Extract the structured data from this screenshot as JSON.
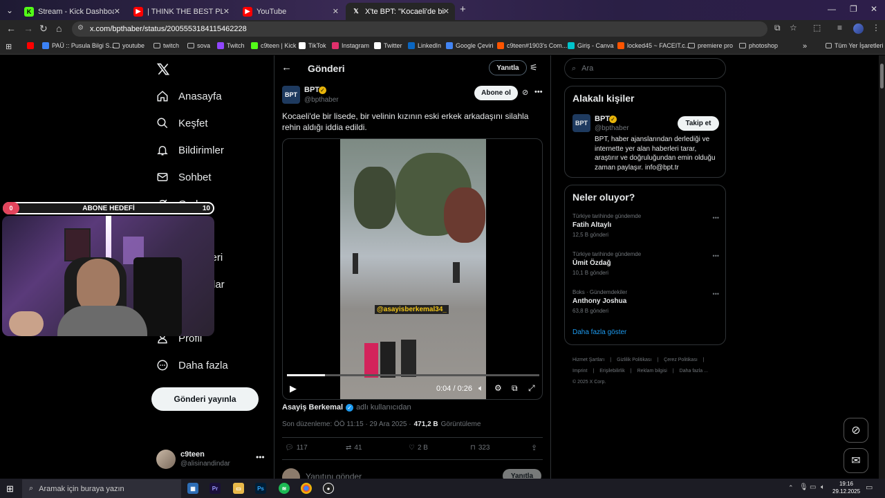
{
  "browser": {
    "tabs": [
      {
        "title": "Stream - Kick Dashboard -",
        "icon": "kick-icon",
        "color": "#53fc18"
      },
      {
        "title": "| THINK THE BEST PLAYER IS 👑",
        "icon": "youtube-icon",
        "color": "#ff0000"
      },
      {
        "title": "YouTube",
        "icon": "youtube-icon",
        "color": "#ff0000"
      },
      {
        "title": "X'te BPT: \"Kocaeli'de bir lisede",
        "icon": "x-icon",
        "color": "#ffffff"
      }
    ],
    "url": "x.com/bpthaber/status/2005553184115462228",
    "bookmarks": [
      {
        "label": "",
        "icon": "youtube-icon",
        "color": "#ff0000"
      },
      {
        "label": "PAÜ :: Pusula Bilgi S...",
        "icon": "globe-icon",
        "color": "#3b82f6"
      },
      {
        "label": "youtube",
        "icon": "folder-icon",
        "color": "#bbbbbb"
      },
      {
        "label": "twitch",
        "icon": "folder-icon",
        "color": "#bbbbbb"
      },
      {
        "label": "sova",
        "icon": "folder-icon",
        "color": "#bbbbbb"
      },
      {
        "label": "Twitch",
        "icon": "twitch-icon",
        "color": "#9146ff"
      },
      {
        "label": "c9teen | Kick",
        "icon": "kick-icon",
        "color": "#53fc18"
      },
      {
        "label": "TikTok",
        "icon": "tiktok-icon",
        "color": "#ffffff"
      },
      {
        "label": "Instagram",
        "icon": "instagram-icon",
        "color": "#e1306c"
      },
      {
        "label": "Twitter",
        "icon": "x-icon",
        "color": "#ffffff"
      },
      {
        "label": "LinkedIn",
        "icon": "linkedin-icon",
        "color": "#0a66c2"
      },
      {
        "label": "Google Çeviri",
        "icon": "translate-icon",
        "color": "#4285f4"
      },
      {
        "label": "c9teen#1903's Com...",
        "icon": "faceit-icon",
        "color": "#ff5500"
      },
      {
        "label": "Giriş - Canva",
        "icon": "canva-icon",
        "color": "#00c4cc"
      },
      {
        "label": "locked45 ~ FACEIT.c...",
        "icon": "faceit-icon",
        "color": "#ff5500"
      },
      {
        "label": "premiere pro",
        "icon": "folder-icon",
        "color": "#bbbbbb"
      },
      {
        "label": "photoshop",
        "icon": "folder-icon",
        "color": "#bbbbbb"
      }
    ],
    "all_bookmarks": "Tüm Yer İşaretleri"
  },
  "sidebar": {
    "items": [
      {
        "label": "Anasayfa",
        "icon": "home-icon"
      },
      {
        "label": "Keşfet",
        "icon": "search-icon"
      },
      {
        "label": "Bildirimler",
        "icon": "bell-icon"
      },
      {
        "label": "Sohbet",
        "icon": "mail-icon"
      },
      {
        "label": "Grok",
        "icon": "grok-icon"
      },
      {
        "label": "tleri",
        "icon": "list-icon"
      },
      {
        "label": "lar",
        "icon": "communities-icon"
      },
      {
        "label": "",
        "icon": "premium-icon"
      },
      {
        "label": "Profil",
        "icon": "profile-icon"
      },
      {
        "label": "Daha fazla",
        "icon": "more-circle-icon"
      }
    ],
    "post_button": "Gönderi yayınla",
    "account": {
      "name": "c9teen",
      "handle": "@alisinandindar"
    }
  },
  "stream_overlay": {
    "goal_label": "ABONE HEDEFİ",
    "goal_current": "0",
    "goal_target": "10"
  },
  "post": {
    "header": "Gönderi",
    "reply_button": "Yanıtla",
    "author_name": "BPT",
    "author_handle": "@bpthaber",
    "follow_button": "Abone ol",
    "text": "Kocaeli'de bir lisede, bir velinin kızının eski erkek arkadaşını silahla rehin aldığı iddia edildi.",
    "video": {
      "watermark": "@asayisberkemal34_",
      "time": "0:04 / 0:26",
      "progress": 0.15
    },
    "credit_user": "Asayiş Berkemal",
    "credit_suffix": "adlı kullanıcıdan",
    "edited": "Son düzenleme: ÖÖ 11:15 · 29 Ara 2025 ·",
    "views_count": "471,2 B",
    "views_label": "Görüntüleme",
    "stats": {
      "replies": "117",
      "reposts": "41",
      "likes": "2 B",
      "bookmarks": "323"
    },
    "reply_placeholder": "Yanıtını gönder",
    "reply_submit": "Yanıtla"
  },
  "right": {
    "search_placeholder": "Ara",
    "related_title": "Alakalı kişiler",
    "related": {
      "name": "BPT",
      "handle": "@bpthaber",
      "follow": "Takip et",
      "bio": "BPT, haber ajanslarından derlediği ve internette yer alan haberleri tarar, araştırır ve doğruluğundan emin olduğu zaman paylaşır. info@bpt.tr"
    },
    "trends_title": "Neler oluyor?",
    "trends": [
      {
        "category": "Türkiye tarihinde gündemde",
        "name": "Fatih Altaylı",
        "count": "12,5 B gönderi"
      },
      {
        "category": "Türkiye tarihinde gündemde",
        "name": "Ümit Özdağ",
        "count": "10,1 B gönderi"
      },
      {
        "category": "Boks · Gündemdekiler",
        "name": "Anthony Joshua",
        "count": "63,8 B gönderi"
      }
    ],
    "show_more": "Daha fazla göster",
    "footer_row1": [
      "Hizmet Şartları",
      "Gizlilik Politikası",
      "Çerez Politikası"
    ],
    "footer_row2": [
      "Imprint",
      "Erişilebilirlik",
      "Reklam bilgisi",
      "Daha fazla ..."
    ],
    "copyright": "© 2025 X Corp."
  },
  "taskbar": {
    "search_placeholder": "Aramak için buraya yazın",
    "time": "19:16",
    "date": "29.12.2025"
  }
}
